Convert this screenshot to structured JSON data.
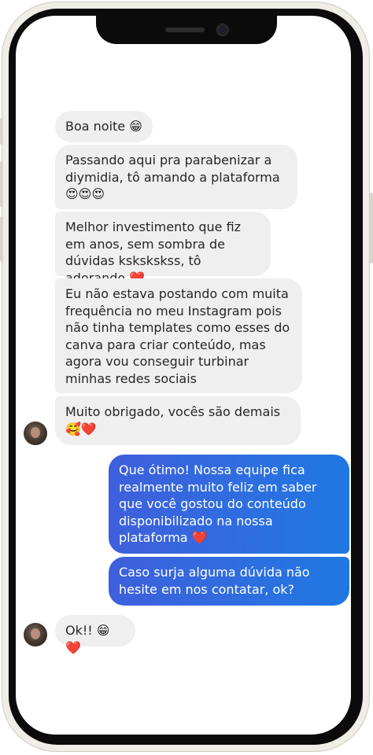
{
  "messages": {
    "m1": "Boa noite 😁",
    "m2": "Passando aqui pra parabenizar a diymidia, tô amando a plataforma 😍😍😍",
    "m3": "Melhor investimento que fiz em anos, sem sombra de dúvidas kskskskss, tô adorando ❤️",
    "m4": "Eu não estava postando com muita frequência no meu Instagram pois não tinha templates como esses do canva para criar conteúdo, mas agora vou conseguir turbinar minhas redes sociais",
    "m5": "Muito obrigado, vocês são demais 🥰❤️",
    "r1": "Que ótimo! Nossa equipe fica realmente muito feliz em saber que você gostou do conteúdo disponibilizado na nossa plataforma ❤️",
    "r2": "Caso surja alguma dúvida não hesite em nos contatar, ok?",
    "m6": "Ok!! 😁❤️"
  },
  "colors": {
    "incoming_bubble": "#efefef",
    "outgoing_gradient_start": "#3e5fdc",
    "outgoing_gradient_end": "#1f78e2"
  }
}
